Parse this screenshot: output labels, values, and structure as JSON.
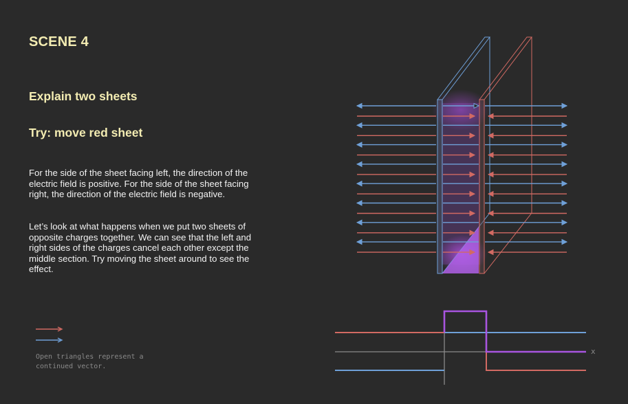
{
  "scene": {
    "title": "SCENE 4"
  },
  "headings": {
    "explain": "Explain two sheets",
    "try": "Try: move red sheet"
  },
  "paragraphs": [
    "For the side of the sheet facing left, the direction of the electric field  is positive. For the side of the sheet facing right, the direction of the electric field is negative.",
    "Let’s look at what happens when we put two sheets of opposite charges together. We can see that the left and right sides of the charges cancel each other except the middle section. Try moving the sheet around to see the effect."
  ],
  "legend": {
    "note": "Open triangles represent a continued vector."
  },
  "graph": {
    "axis_label": "x"
  },
  "colors": {
    "background": "#2a2a2a",
    "title": "#f3ecb2",
    "red": "#d26a63",
    "blue": "#6fa0d8",
    "purple": "#a855e0",
    "axis": "#8a8a8a"
  }
}
